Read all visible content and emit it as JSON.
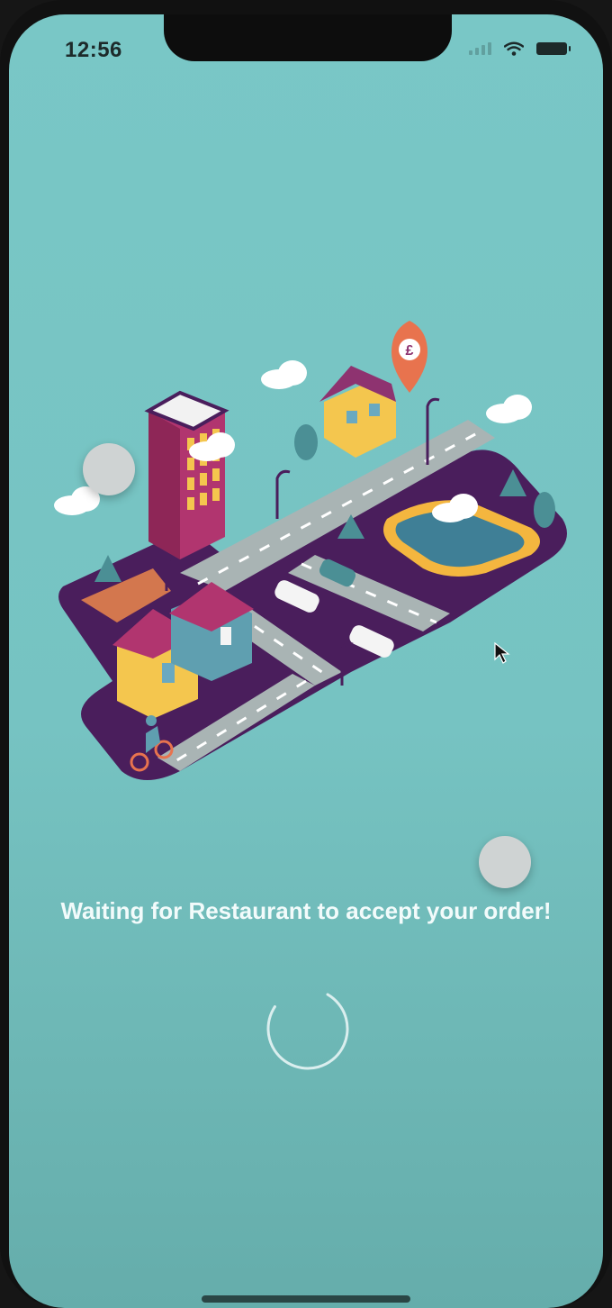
{
  "status_bar": {
    "time": "12:56",
    "icons": [
      "signal-icon",
      "wifi-icon",
      "battery-icon"
    ]
  },
  "illustration": {
    "name": "isometric-city-map-illustration",
    "pin_symbol": "£"
  },
  "message": "Waiting for Restaurant to accept your order!",
  "loading": {
    "name": "loading-spinner"
  },
  "colors": {
    "background": "#78c5c4",
    "map_base": "#4a1e5c",
    "road": "#a9b4b4",
    "building_magenta": "#b1356f",
    "accent_orange": "#e8734e",
    "text": "#f2fbfb"
  }
}
